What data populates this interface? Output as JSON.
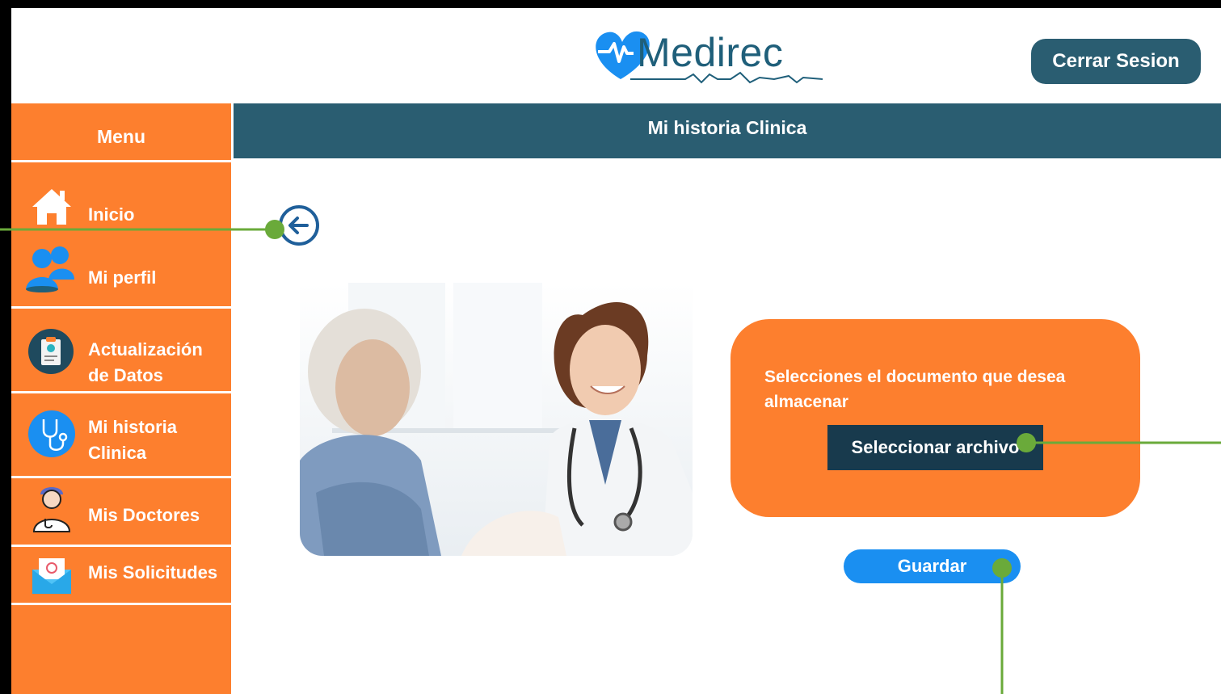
{
  "header": {
    "logo_text": "Medirec",
    "logout_label": "Cerrar Sesion"
  },
  "page": {
    "title": "Mi historia Clinica"
  },
  "sidebar": {
    "title": "Menu",
    "items": [
      {
        "label": "Inicio",
        "icon": "home-icon"
      },
      {
        "label": "Mi perfil",
        "icon": "users-icon"
      },
      {
        "label": "Actualización de Datos",
        "icon": "clipboard-icon"
      },
      {
        "label": "Mi historia Clinica",
        "icon": "stethoscope-icon"
      },
      {
        "label": "Mis Doctores",
        "icon": "doctor-icon"
      },
      {
        "label": "Mis Solicitudes",
        "icon": "mail-icon"
      }
    ]
  },
  "upload": {
    "prompt": "Selecciones el documento que desea almacenar",
    "select_label": "Seleccionar archivo",
    "save_label": "Guardar"
  },
  "colors": {
    "accent_orange": "#fd7f2e",
    "header_teal": "#2a5d71",
    "button_dark": "#183a4d",
    "save_blue": "#1a8ff1",
    "annotation_green": "#6aaa3a"
  }
}
